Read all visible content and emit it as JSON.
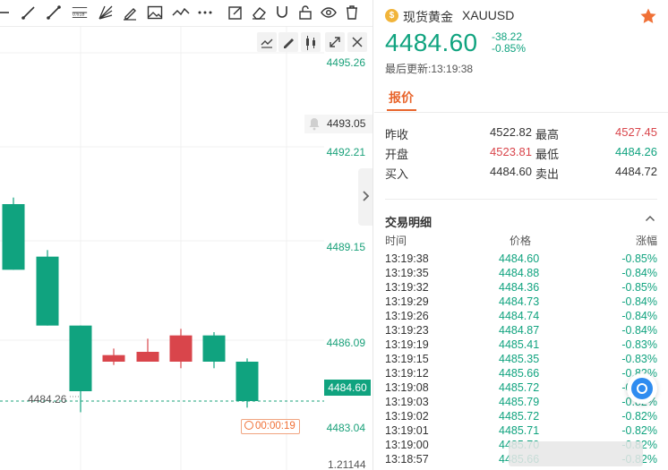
{
  "toolbar": {
    "icons": [
      "line-tool-icon",
      "ray-tool-icon",
      "trend-line-icon",
      "fibonacci-icon",
      "fan-icon",
      "brush-icon",
      "image-icon",
      "wave-icon",
      "more-icon",
      "note-icon",
      "eraser-icon",
      "magnet-icon",
      "lock-icon",
      "eye-icon",
      "trash-icon"
    ],
    "fib_label": "0.618"
  },
  "chart": {
    "price_ticks": [
      "4495.26",
      "4492.21",
      "4489.15",
      "4486.09",
      "4483.04"
    ],
    "bell_price": "4493.05",
    "current_price": "4484.60",
    "low_label": "4484.26",
    "countdown": "00:00:19",
    "bottom_number": "1.21144",
    "colors": {
      "up": "#d9454b",
      "down": "#10a37f",
      "price_line": "#1aa17a"
    }
  },
  "chart_data": {
    "type": "candlestick",
    "ylim": [
      4482.5,
      4496.0
    ],
    "candles": [
      {
        "open": 4490.6,
        "close": 4488.6,
        "high": 4490.8,
        "low": 4488.6
      },
      {
        "open": 4489.0,
        "close": 4486.9,
        "high": 4489.2,
        "low": 4486.9
      },
      {
        "open": 4486.9,
        "close": 4484.9,
        "high": 4486.9,
        "low": 4484.26
      },
      {
        "open": 4485.8,
        "close": 4486.0,
        "high": 4486.2,
        "low": 4485.7
      },
      {
        "open": 4485.8,
        "close": 4486.1,
        "high": 4486.5,
        "low": 4485.8
      },
      {
        "open": 4485.8,
        "close": 4486.6,
        "high": 4486.8,
        "low": 4485.6
      },
      {
        "open": 4486.6,
        "close": 4485.8,
        "high": 4486.7,
        "low": 4485.6
      },
      {
        "open": 4485.8,
        "close": 4484.6,
        "high": 4485.9,
        "low": 4484.4
      }
    ]
  },
  "quote": {
    "name": "现货黄金",
    "code": "XAUUSD",
    "price": "4484.60",
    "change": "-38.22",
    "change_pct": "-0.85%",
    "update_time": "最后更新:13:19:38",
    "tab_label": "报价",
    "stats": [
      {
        "label": "昨收",
        "value": "4522.82",
        "tone": ""
      },
      {
        "label": "最高",
        "value": "4527.45",
        "tone": "up"
      },
      {
        "label": "开盘",
        "value": "4523.81",
        "tone": "up"
      },
      {
        "label": "最低",
        "value": "4484.26",
        "tone": "down"
      },
      {
        "label": "买入",
        "value": "4484.60",
        "tone": ""
      },
      {
        "label": "卖出",
        "value": "4484.72",
        "tone": ""
      }
    ]
  },
  "trades": {
    "title": "交易明细",
    "headers": {
      "time": "时间",
      "price": "价格",
      "pct": "涨幅"
    },
    "rows": [
      {
        "time": "13:19:38",
        "price": "4484.60",
        "pct": "-0.85%"
      },
      {
        "time": "13:19:35",
        "price": "4484.88",
        "pct": "-0.84%"
      },
      {
        "time": "13:19:32",
        "price": "4484.36",
        "pct": "-0.85%"
      },
      {
        "time": "13:19:29",
        "price": "4484.73",
        "pct": "-0.84%"
      },
      {
        "time": "13:19:26",
        "price": "4484.74",
        "pct": "-0.84%"
      },
      {
        "time": "13:19:23",
        "price": "4484.87",
        "pct": "-0.84%"
      },
      {
        "time": "13:19:19",
        "price": "4485.41",
        "pct": "-0.83%"
      },
      {
        "time": "13:19:15",
        "price": "4485.35",
        "pct": "-0.83%"
      },
      {
        "time": "13:19:12",
        "price": "4485.66",
        "pct": "-0.82%"
      },
      {
        "time": "13:19:08",
        "price": "4485.72",
        "pct": "-0.82%"
      },
      {
        "time": "13:19:03",
        "price": "4485.79",
        "pct": "-0.82%"
      },
      {
        "time": "13:19:02",
        "price": "4485.72",
        "pct": "-0.82%"
      },
      {
        "time": "13:19:01",
        "price": "4485.71",
        "pct": "-0.82%"
      },
      {
        "time": "13:19:00",
        "price": "4485.70",
        "pct": "-0.82%"
      },
      {
        "time": "13:18:57",
        "price": "4485.66",
        "pct": "-0.82%"
      }
    ]
  }
}
